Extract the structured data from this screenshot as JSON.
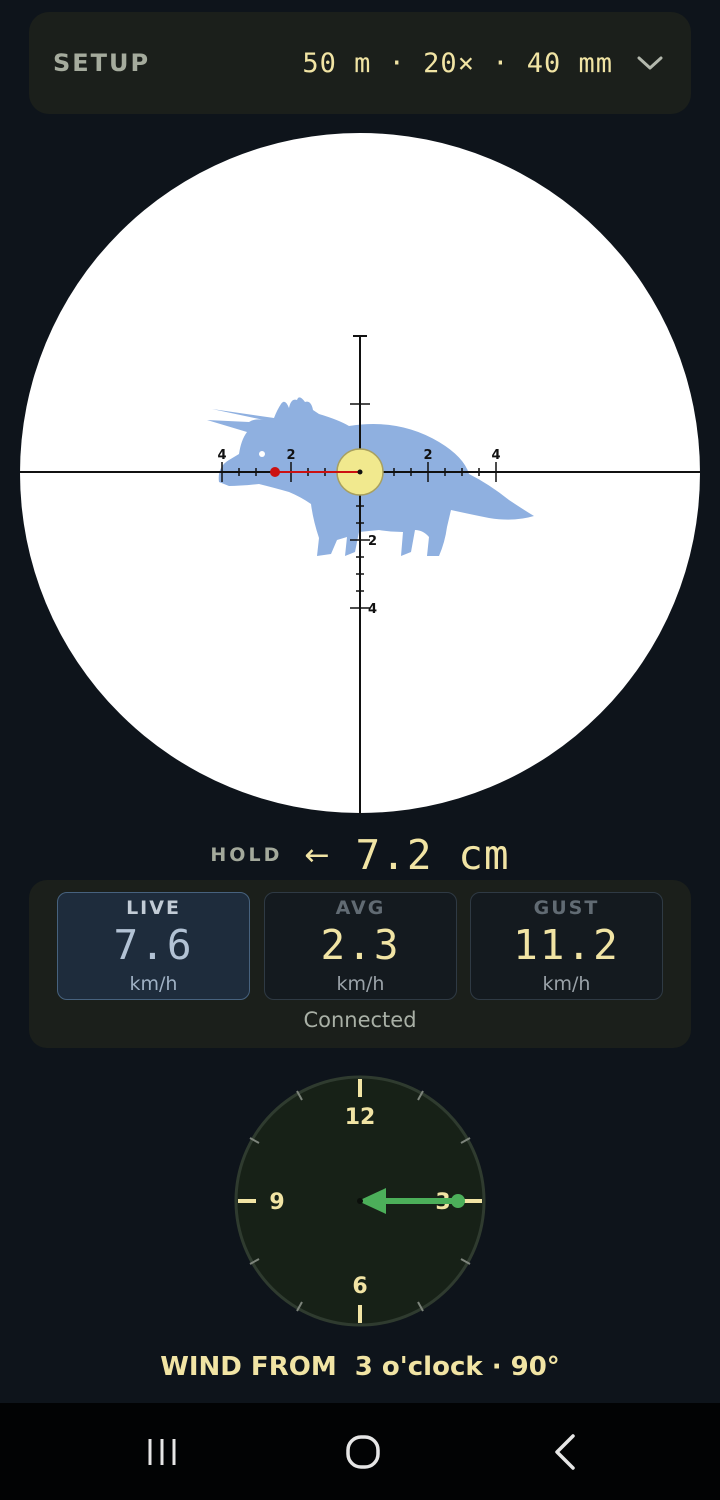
{
  "setup": {
    "label": "SETUP",
    "value": "50 m · 20× · 40 mm"
  },
  "reticle": {
    "left_labels": [
      "4",
      "2"
    ],
    "right_labels": [
      "2",
      "4"
    ],
    "down_labels": [
      "2",
      "4"
    ],
    "target": "triceratops"
  },
  "hold": {
    "label": "HOLD",
    "direction_arrow": "←",
    "value": "7.2 cm"
  },
  "wind": {
    "cards": [
      {
        "label": "LIVE",
        "value": "7.6",
        "unit": "km/h",
        "active": true
      },
      {
        "label": "AVG",
        "value": "2.3",
        "unit": "km/h",
        "active": false
      },
      {
        "label": "GUST",
        "value": "11.2",
        "unit": "km/h",
        "active": false
      }
    ],
    "status": "Connected"
  },
  "clock": {
    "numerals": {
      "twelve": "12",
      "three": "3",
      "six": "6",
      "nine": "9"
    },
    "wind_direction_oclock": 3
  },
  "wind_from": "WIND FROM  3 o'clock · 90°",
  "colors": {
    "background": "#0e141b",
    "panel": "#1b1f1b",
    "accent": "#f1e4a4",
    "live": "#b2c2d4",
    "wind_arrow": "#4caf5a",
    "target": "#8fb0e0",
    "aim_point": "#cc1111"
  },
  "nav": {
    "recents_icon": "recents-icon",
    "home_icon": "home-icon",
    "back_icon": "back-icon"
  }
}
